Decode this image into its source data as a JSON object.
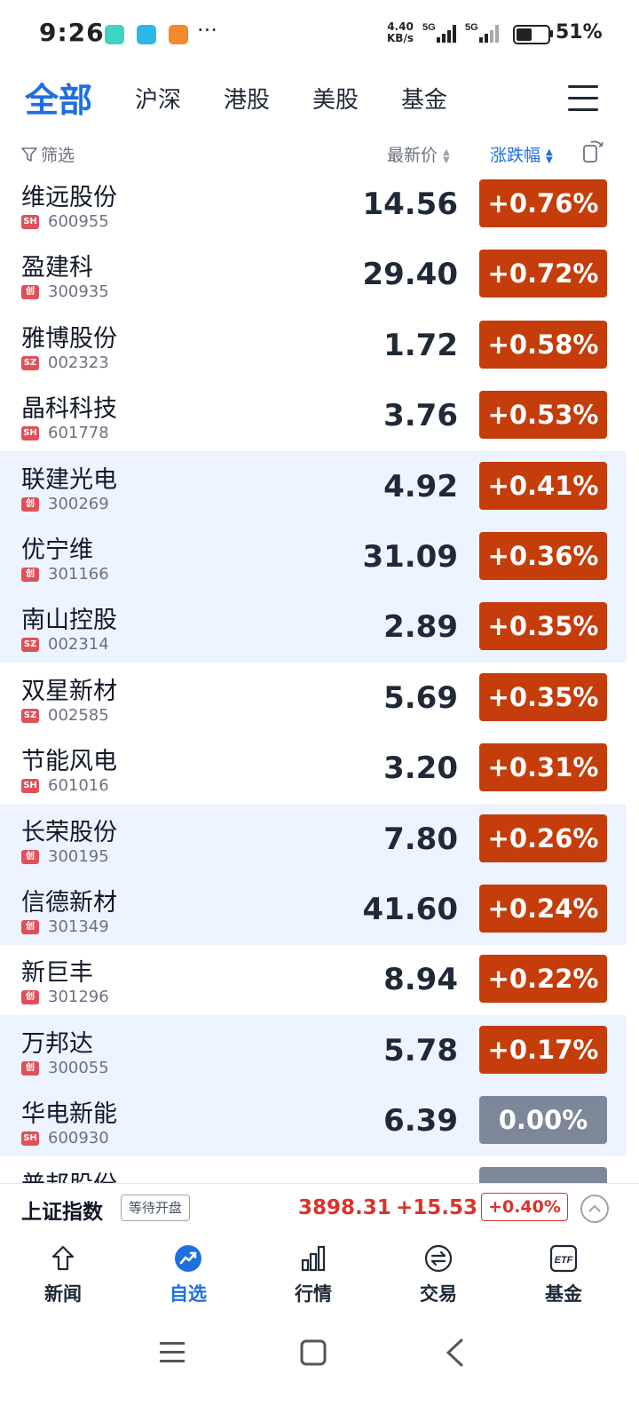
{
  "status_bar": {
    "time": "9:26",
    "net_speed_value": "4.40",
    "net_speed_unit": "KB/s",
    "signal_1": "5G",
    "signal_2": "5G",
    "battery_pct": "51%",
    "battery_level": 0.51,
    "more": "···"
  },
  "tabs": [
    {
      "label": "全部",
      "active": true
    },
    {
      "label": "沪深",
      "active": false
    },
    {
      "label": "港股",
      "active": false
    },
    {
      "label": "美股",
      "active": false
    },
    {
      "label": "基金",
      "active": false
    }
  ],
  "header": {
    "filter_label": "筛选",
    "price_label": "最新价",
    "change_label": "涨跌幅"
  },
  "stocks": [
    {
      "name": "维远股份",
      "market": "SH",
      "code": "600955",
      "price": "14.56",
      "change": "+0.76%"
    },
    {
      "name": "盈建科",
      "market": "创",
      "code": "300935",
      "price": "29.40",
      "change": "+0.72%"
    },
    {
      "name": "雅博股份",
      "market": "SZ",
      "code": "002323",
      "price": "1.72",
      "change": "+0.58%"
    },
    {
      "name": "晶科科技",
      "market": "SH",
      "code": "601778",
      "price": "3.76",
      "change": "+0.53%"
    },
    {
      "name": "联建光电",
      "market": "创",
      "code": "300269",
      "price": "4.92",
      "change": "+0.41%"
    },
    {
      "name": "优宁维",
      "market": "创",
      "code": "301166",
      "price": "31.09",
      "change": "+0.36%"
    },
    {
      "name": "南山控股",
      "market": "SZ",
      "code": "002314",
      "price": "2.89",
      "change": "+0.35%"
    },
    {
      "name": "双星新材",
      "market": "SZ",
      "code": "002585",
      "price": "5.69",
      "change": "+0.35%"
    },
    {
      "name": "节能风电",
      "market": "SH",
      "code": "601016",
      "price": "3.20",
      "change": "+0.31%"
    },
    {
      "name": "长荣股份",
      "market": "创",
      "code": "300195",
      "price": "7.80",
      "change": "+0.26%"
    },
    {
      "name": "信德新材",
      "market": "创",
      "code": "301349",
      "price": "41.60",
      "change": "+0.24%"
    },
    {
      "name": "新巨丰",
      "market": "创",
      "code": "301296",
      "price": "8.94",
      "change": "+0.22%"
    },
    {
      "name": "万邦达",
      "market": "创",
      "code": "300055",
      "price": "5.78",
      "change": "+0.17%"
    },
    {
      "name": "华电新能",
      "market": "SH",
      "code": "600930",
      "price": "6.39",
      "change": "0.00%"
    },
    {
      "name": "普邦股份",
      "market": "",
      "code": "",
      "price": "",
      "change": ""
    }
  ],
  "colors": {
    "accent": "#1e6fe0",
    "up_bg": "#c43d0b",
    "flat_bg": "#7d879a",
    "row_highlight": "#eef4ff",
    "badge_sh": "#e0505a",
    "badge_sz": "#e0505a",
    "badge_cy": "#e0505a",
    "index_red": "#d9342b"
  },
  "index_bar": {
    "name": "上证指数",
    "status": "等待开盘",
    "value": "3898.31",
    "change": "+15.53",
    "pct": "+0.40%"
  },
  "bottom_nav": [
    {
      "label": "新闻",
      "icon": "news-icon",
      "active": false
    },
    {
      "label": "自选",
      "icon": "watchlist-icon",
      "active": true
    },
    {
      "label": "行情",
      "icon": "market-icon",
      "active": false
    },
    {
      "label": "交易",
      "icon": "trade-icon",
      "active": false
    },
    {
      "label": "基金",
      "icon": "etf-icon",
      "active": false
    }
  ],
  "etf_icon_text": "ETF",
  "system_nav": [
    "menu-icon",
    "home-icon",
    "back-icon"
  ]
}
